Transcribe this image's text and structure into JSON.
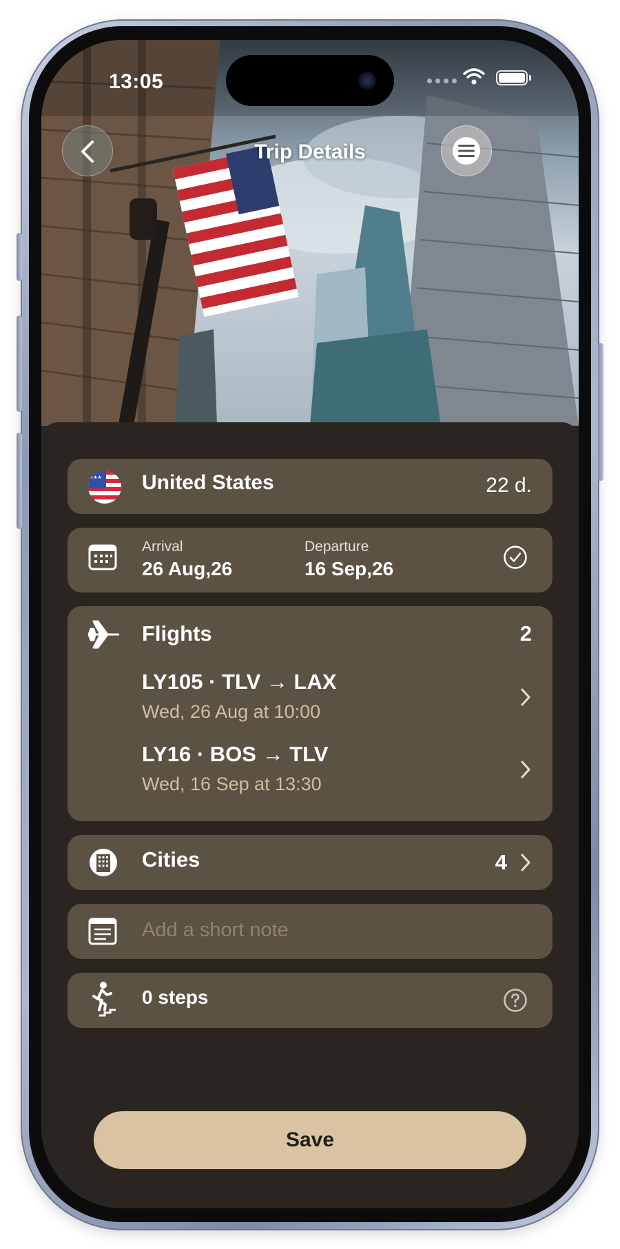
{
  "status_bar": {
    "time": "13:05"
  },
  "nav": {
    "title": "Trip Details"
  },
  "country": {
    "name": "United States",
    "duration": "22 d."
  },
  "dates": {
    "arrival_label": "Arrival",
    "arrival_value": "26 Aug,26",
    "departure_label": "Departure",
    "departure_value": "16 Sep,26"
  },
  "flights": {
    "label": "Flights",
    "count": "2",
    "items": [
      {
        "route": "LY105 · TLV → LAX",
        "when": "Wed, 26 Aug at 10:00"
      },
      {
        "route": "LY16 · BOS → TLV",
        "when": "Wed, 16 Sep at 13:30"
      }
    ]
  },
  "cities": {
    "label": "Cities",
    "count": "4"
  },
  "note": {
    "placeholder": "Add a short note"
  },
  "steps": {
    "label": "0 steps"
  },
  "save": {
    "label": "Save"
  },
  "colors": {
    "card": "#5c5244",
    "sheet": "#2a2520",
    "accent": "#d9c3a2",
    "muted_text": "#d2bda2"
  },
  "icons": [
    "chevron-left-icon",
    "menu-icon",
    "flag-us-icon",
    "calendar-icon",
    "check-circle-icon",
    "airplane-icon",
    "chevron-right-icon",
    "building-icon",
    "note-icon",
    "stairs-person-icon",
    "help-circle-icon",
    "wifi-icon",
    "battery-icon"
  ]
}
